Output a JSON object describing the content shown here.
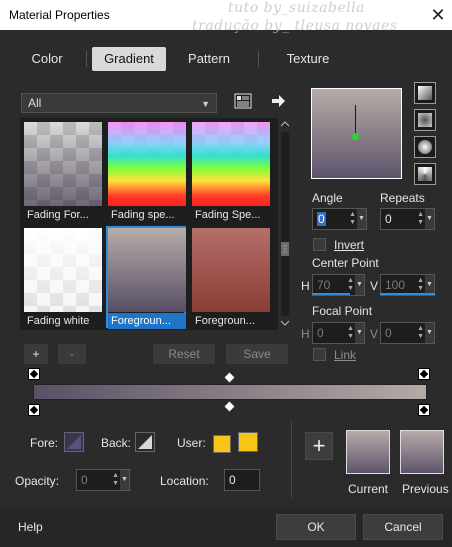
{
  "window": {
    "title": "Material Properties",
    "close_glyph": "✕",
    "watermark_1": "tuto by_suizabella",
    "watermark_2": "tradução by_ tleusa novaes"
  },
  "tabs": [
    {
      "label": "Color",
      "active": false
    },
    {
      "label": "Gradient",
      "active": true
    },
    {
      "label": "Pattern",
      "active": false
    },
    {
      "label": "Texture",
      "active": false
    }
  ],
  "category": {
    "selected": "All"
  },
  "gallery": {
    "items": [
      {
        "label": "Fading For...",
        "kind": "checker-fade",
        "selected": false
      },
      {
        "label": "Fading spe...",
        "kind": "spectrum-fade",
        "selected": false
      },
      {
        "label": "Fading Spe...",
        "kind": "spectrum-fade",
        "selected": false
      },
      {
        "label": "Fading white",
        "kind": "checker-white",
        "selected": false
      },
      {
        "label": "Foregroun...",
        "kind": "fg-bg",
        "selected": true
      },
      {
        "label": "Foregroun...",
        "kind": "fg-red",
        "selected": false
      }
    ],
    "add_label": "+",
    "remove_label": "-",
    "reset_label": "Reset",
    "save_label": "Save"
  },
  "properties": {
    "angle_label": "Angle",
    "angle_value": "0",
    "repeats_label": "Repeats",
    "repeats_value": "0",
    "invert_label": "Invert",
    "center_point_label": "Center Point",
    "center_h_label": "H",
    "center_h_value": "70",
    "center_v_label": "V",
    "center_v_value": "100",
    "focal_point_label": "Focal Point",
    "focal_h_label": "H",
    "focal_h_value": "0",
    "focal_v_label": "V",
    "focal_v_value": "0",
    "link_label": "Link"
  },
  "swatches": {
    "fore_label": "Fore:",
    "back_label": "Back:",
    "user_label": "User:",
    "user_color": "#f5c518",
    "opacity_label": "Opacity:",
    "opacity_value": "0",
    "location_label": "Location:",
    "location_value": "0"
  },
  "preview": {
    "current_label": "Current",
    "previous_label": "Previous",
    "add_label": "+"
  },
  "footer": {
    "help_label": "Help",
    "ok_label": "OK",
    "cancel_label": "Cancel"
  },
  "colors": {
    "gradient_start": "#5a5066",
    "gradient_end": "#b5aaa5",
    "accent": "#2f8ddb"
  }
}
